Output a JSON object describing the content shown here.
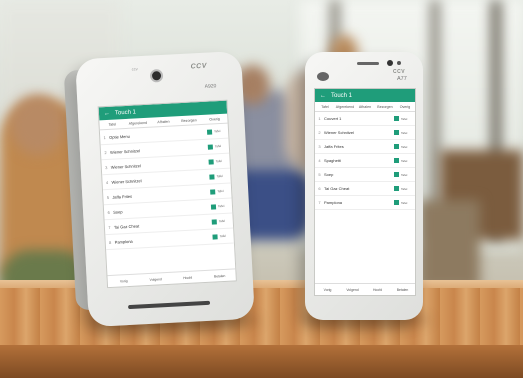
{
  "device_left": {
    "logo_text": "ccv",
    "brand": "CCV",
    "model": "A920",
    "app_title": "Touch 1",
    "tabs": [
      "Tafel",
      "Afgerekend",
      "Afhalen",
      "Bezorgen",
      "Overig"
    ],
    "rows": [
      {
        "num": "1",
        "name": "Optie Menu",
        "tag": "Tafel"
      },
      {
        "num": "2",
        "name": "Wiener Schnitzel",
        "tag": "Tafel"
      },
      {
        "num": "3",
        "name": "Wiener Schnitzel",
        "tag": "Tafel"
      },
      {
        "num": "4",
        "name": "Wiener Schnitzel",
        "tag": "Tafel"
      },
      {
        "num": "5",
        "name": "Jaffa Frites",
        "tag": "Tafel"
      },
      {
        "num": "6",
        "name": "Soep",
        "tag": "Tafel"
      },
      {
        "num": "7",
        "name": "Tai Gaz Cheat",
        "tag": "Tafel"
      },
      {
        "num": "8",
        "name": "Pamplona",
        "tag": "Tafel"
      }
    ],
    "bottom": [
      "Vorig",
      "Volgend",
      "Hoofd",
      "Betalen"
    ]
  },
  "device_right": {
    "brand": "CCV",
    "model": "A77",
    "app_title": "Touch 1",
    "tabs": [
      "Tafel",
      "Afgerekend",
      "Afhalen",
      "Bezorgen",
      "Overig"
    ],
    "rows": [
      {
        "num": "1",
        "name": "Couvert 1",
        "tag": "Tafel"
      },
      {
        "num": "2",
        "name": "Wiener Schnitzel",
        "tag": "Tafel"
      },
      {
        "num": "3",
        "name": "Jaffa Frites",
        "tag": "Tafel"
      },
      {
        "num": "4",
        "name": "Spaghetti",
        "tag": "Tafel"
      },
      {
        "num": "5",
        "name": "Soep",
        "tag": "Tafel"
      },
      {
        "num": "6",
        "name": "Tai Gaz Cheat",
        "tag": "Tafel"
      },
      {
        "num": "7",
        "name": "Pamplona",
        "tag": "Tafel"
      }
    ],
    "bottom": [
      "Vorig",
      "Volgend",
      "Hoofd",
      "Betalen"
    ]
  }
}
